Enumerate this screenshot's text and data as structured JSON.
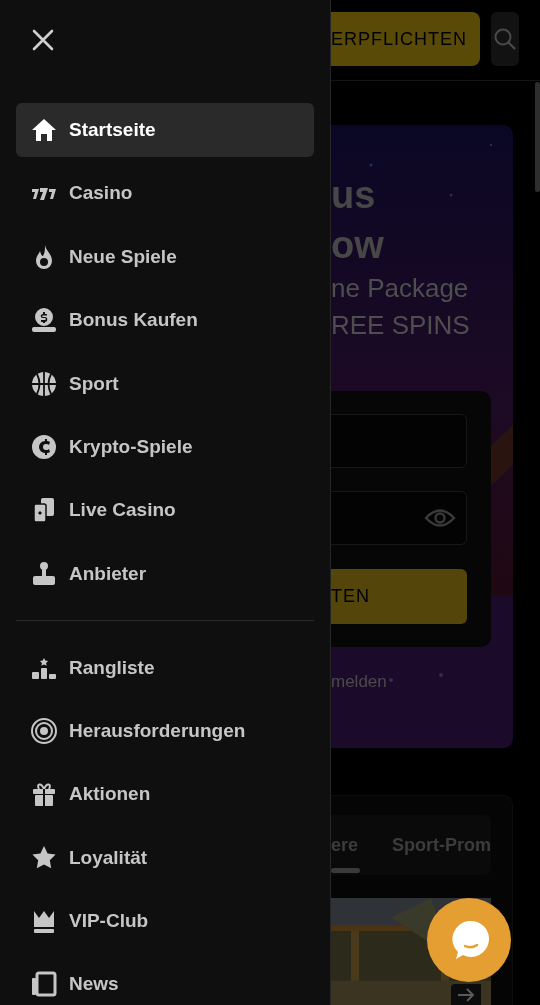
{
  "drawer": {
    "sections": [
      {
        "items": [
          {
            "label": "Startseite",
            "selected": true
          },
          {
            "label": "Casino",
            "selected": false
          },
          {
            "label": "Neue Spiele",
            "selected": false
          },
          {
            "label": "Bonus Kaufen",
            "selected": false
          },
          {
            "label": "Sport",
            "selected": false
          },
          {
            "label": "Krypto-Spiele",
            "selected": false
          },
          {
            "label": "Live Casino",
            "selected": false
          },
          {
            "label": "Anbieter",
            "selected": false
          }
        ]
      },
      {
        "items": [
          {
            "label": "Rangliste",
            "selected": false
          },
          {
            "label": "Herausforderungen",
            "selected": false
          },
          {
            "label": "Aktionen",
            "selected": false
          },
          {
            "label": "Loyalität",
            "selected": false
          },
          {
            "label": "VIP-Club",
            "selected": false
          },
          {
            "label": "News",
            "selected": false
          }
        ]
      }
    ]
  },
  "header": {
    "cta_label": "ERPFLICHTEN"
  },
  "banner": {
    "title_lines": [
      "us",
      "ow"
    ],
    "subtitle_lines": [
      "ne Package",
      "REE SPINS"
    ],
    "submit_label": "TEN",
    "link": "melden"
  },
  "promo_tabs": [
    {
      "label": "ere",
      "selected": true
    },
    {
      "label": "Sport-Prom",
      "selected": false
    }
  ]
}
